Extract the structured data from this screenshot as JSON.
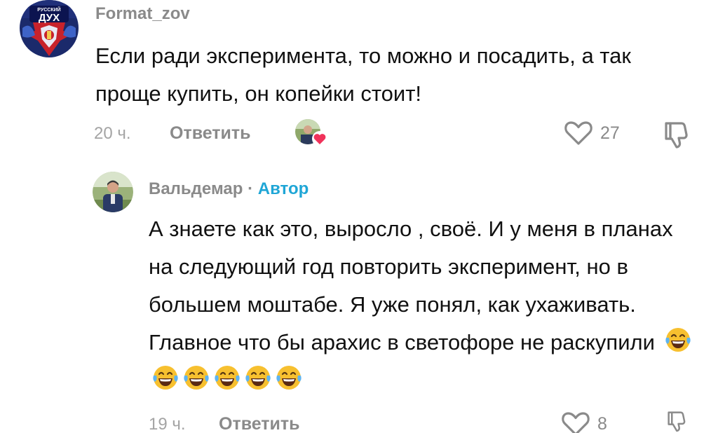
{
  "comments": [
    {
      "username": "Format_zov",
      "avatar_text": "РУССКИЙ ДУХ",
      "text": "Если ради эксперимента, то можно и посадить, а так проще купить, он копейки стоит!",
      "time": "20 ч.",
      "reply_label": "Ответить",
      "likes": "27",
      "liked_by_author": true
    }
  ],
  "replies": [
    {
      "username": "Вальдемар",
      "separator": "·",
      "author_badge": "Автор",
      "text": "А знаете как это, выросло , своё. И у меня в планах на следующий год повторить эксперимент, но в большем моштабе. Я уже понял, как ухаживать. Главное что бы арахис в светофоре не раскупили",
      "emoji_count": 6,
      "emoji_name": "face-with-tears-of-joy",
      "time": "19 ч.",
      "reply_label": "Ответить",
      "likes": "8"
    }
  ],
  "colors": {
    "secondary_text": "#8a8a8a",
    "author_accent": "#1fa6d6",
    "heart_badge": "#f0325a"
  },
  "icons": [
    "heart-outline-icon",
    "dislike-icon",
    "heart-badge-icon",
    "emoji-face-with-tears-of-joy"
  ]
}
